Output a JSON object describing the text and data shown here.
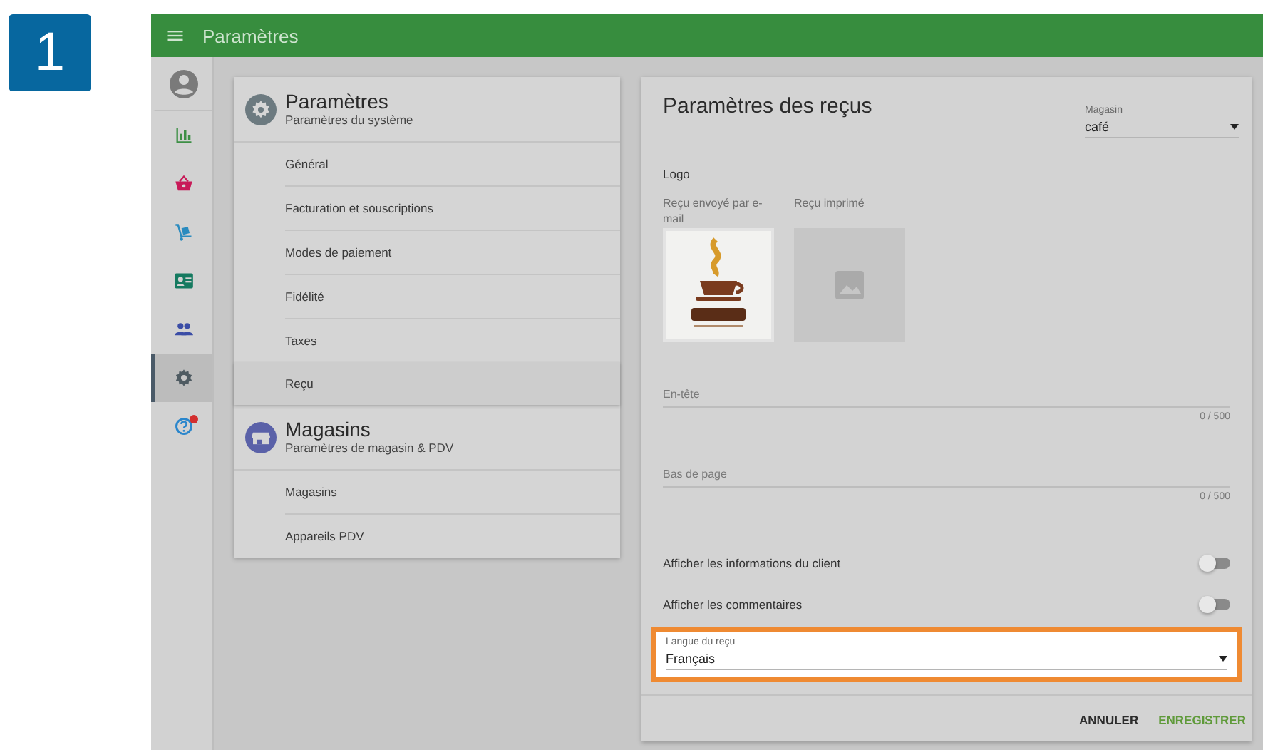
{
  "step_badge": "1",
  "app_bar": {
    "title": "Paramètres"
  },
  "sidebar": {
    "items": [
      {
        "kind": "account",
        "selected": false,
        "notification": false
      },
      {
        "kind": "reports",
        "selected": false,
        "notification": false
      },
      {
        "kind": "basket",
        "selected": false,
        "notification": false
      },
      {
        "kind": "inventory",
        "selected": false,
        "notification": false
      },
      {
        "kind": "customers",
        "selected": false,
        "notification": false
      },
      {
        "kind": "employees",
        "selected": false,
        "notification": false
      },
      {
        "kind": "settings",
        "selected": true,
        "notification": false
      },
      {
        "kind": "help",
        "selected": false,
        "notification": true
      }
    ]
  },
  "settings_menu": {
    "sections": [
      {
        "kind": "settings",
        "title": "Paramètres",
        "subtitle": "Paramètres du système",
        "items": [
          {
            "label": "Général",
            "selected": false
          },
          {
            "label": "Facturation et souscriptions",
            "selected": false
          },
          {
            "label": "Modes de paiement",
            "selected": false
          },
          {
            "label": "Fidélité",
            "selected": false
          },
          {
            "label": "Taxes",
            "selected": false
          },
          {
            "label": "Reçu",
            "selected": true
          }
        ]
      },
      {
        "kind": "store",
        "title": "Magasins",
        "subtitle": "Paramètres de magasin & PDV",
        "items": [
          {
            "label": "Magasins",
            "selected": false
          },
          {
            "label": "Appareils PDV",
            "selected": false
          }
        ]
      }
    ]
  },
  "receipt_settings": {
    "title": "Paramètres des reçus",
    "store_select": {
      "label": "Magasin",
      "value": "café"
    },
    "logo": {
      "label": "Logo",
      "slots": [
        {
          "label": "Reçu envoyé par e-mail",
          "kind": "picture"
        },
        {
          "label": "Reçu imprimé",
          "kind": "empty"
        }
      ]
    },
    "text_fields": [
      {
        "placeholder": "En-tête",
        "counter": "0 / 500"
      },
      {
        "placeholder": "Bas de page",
        "counter": "0 / 500"
      }
    ],
    "toggles": [
      {
        "label": "Afficher les informations du client",
        "on": false
      },
      {
        "label": "Afficher les commentaires",
        "on": false
      }
    ],
    "language_select": {
      "label": "Langue du reçu",
      "value": "Français",
      "highlighted": true
    },
    "buttons": [
      {
        "label": "ANNULER",
        "kind": "cancel"
      },
      {
        "label": "ENREGISTRER",
        "kind": "save"
      }
    ]
  }
}
